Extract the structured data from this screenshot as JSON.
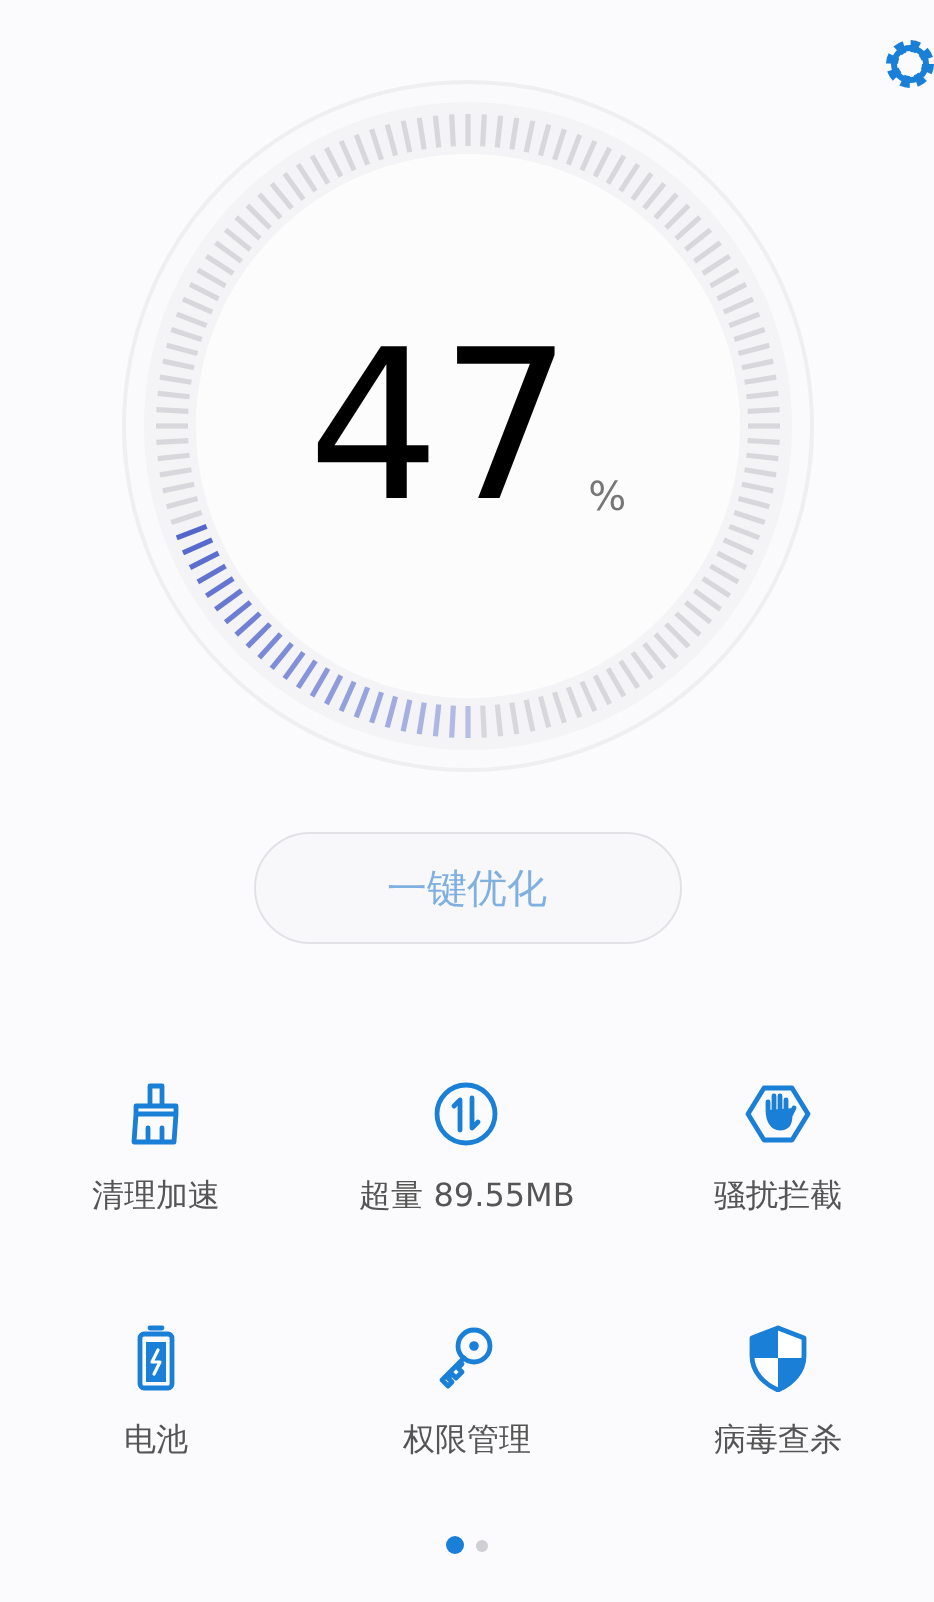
{
  "gauge": {
    "value": "47",
    "unit": "%"
  },
  "optimize_button": {
    "label": "一键优化",
    "disabled": true
  },
  "tools": [
    {
      "kind": "broom",
      "label": "清理加速"
    },
    {
      "kind": "data",
      "label": "超量 89.55MB"
    },
    {
      "kind": "block",
      "label": "骚扰拦截"
    },
    {
      "kind": "battery",
      "label": "电池"
    },
    {
      "kind": "key",
      "label": "权限管理"
    },
    {
      "kind": "shield",
      "label": "病毒查杀"
    }
  ],
  "pages": [
    {
      "selected": true
    },
    {
      "selected": false
    }
  ]
}
